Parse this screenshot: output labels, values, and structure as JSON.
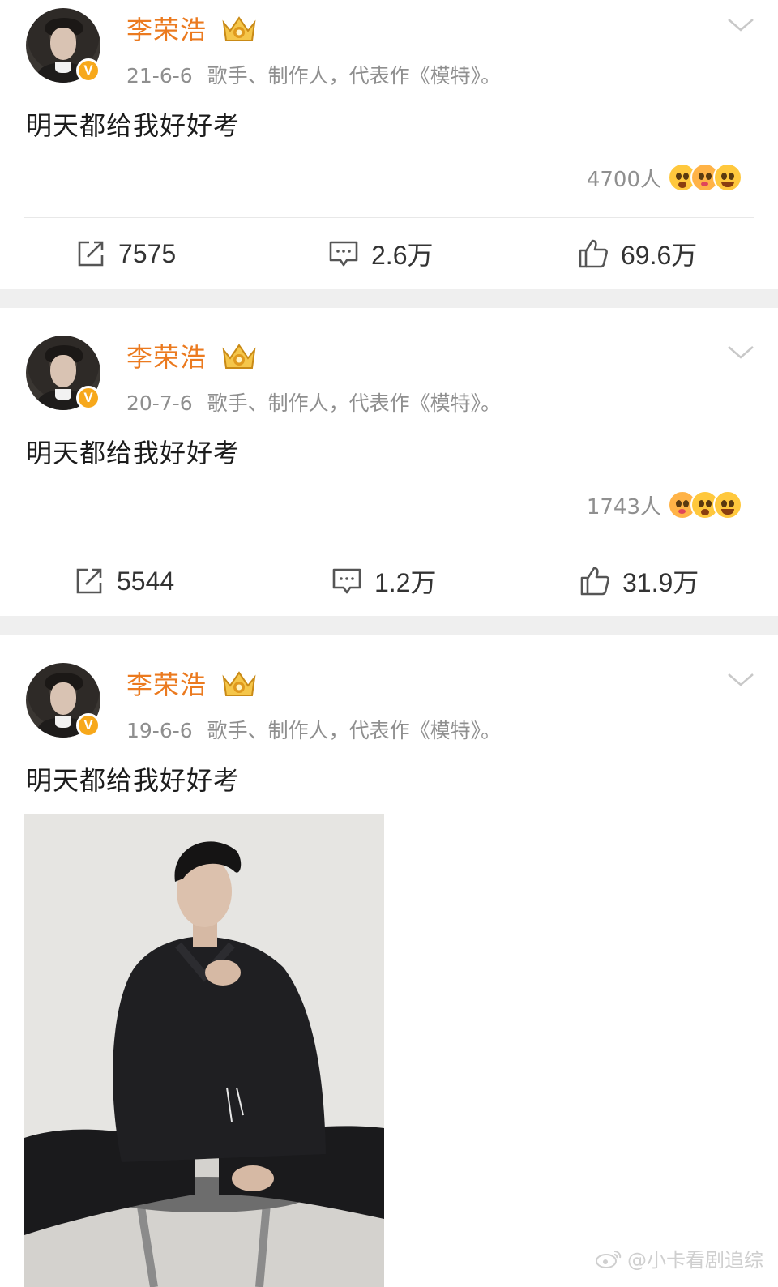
{
  "posts": [
    {
      "author": "李荣浩",
      "date": "21-6-6",
      "bio": "歌手、制作人，代表作《模特》。",
      "text": "明天都给我好好考",
      "reaction_count": "4700人",
      "reposts": "7575",
      "comments": "2.6万",
      "likes": "69.6万"
    },
    {
      "author": "李荣浩",
      "date": "20-7-6",
      "bio": "歌手、制作人，代表作《模特》。",
      "text": "明天都给我好好考",
      "reaction_count": "1743人",
      "reposts": "5544",
      "comments": "1.2万",
      "likes": "31.9万"
    },
    {
      "author": "李荣浩",
      "date": "19-6-6",
      "bio": "歌手、制作人，代表作《模特》。",
      "text": "明天都给我好好考"
    }
  ],
  "verified_badge": "V",
  "watermark": "@小卡看剧追综",
  "colors": {
    "name": "#eb7a1f",
    "separator": "#efefef",
    "meta": "#8f8f8f",
    "badge": "#f7a81b"
  },
  "icons": [
    "crown-icon",
    "chevron-down-icon",
    "repost-icon",
    "comment-icon",
    "like-icon",
    "weibo-logo-icon"
  ]
}
